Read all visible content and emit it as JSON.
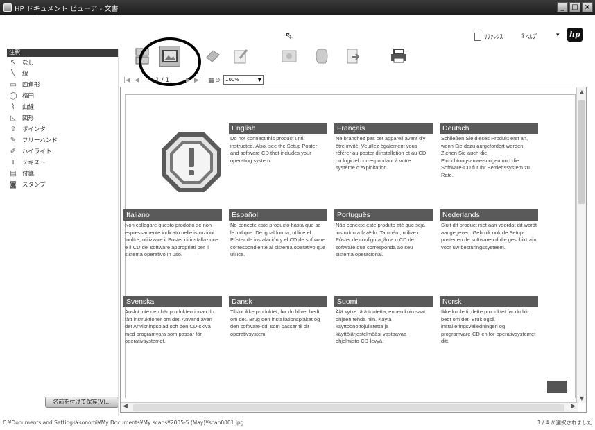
{
  "window": {
    "title": "HP ドキュメント ビューア - 文書",
    "minimize": "_",
    "maximize": "□",
    "close": "×"
  },
  "menu": {
    "reference": "ﾘﾌｧﾚﾝｽ",
    "help": "ﾍﾙﾌﾟ",
    "help_arrow": "▾",
    "brand": "hp"
  },
  "sidebar": {
    "header": "注釈",
    "items": [
      {
        "label": "なし",
        "icon": "pointer-icon",
        "glyph": "↖"
      },
      {
        "label": "線",
        "icon": "line-icon",
        "glyph": "╲"
      },
      {
        "label": "四角形",
        "icon": "rectangle-icon",
        "glyph": "▭"
      },
      {
        "label": "楕円",
        "icon": "ellipse-icon",
        "glyph": "◯"
      },
      {
        "label": "曲線",
        "icon": "curve-icon",
        "glyph": "⌇"
      },
      {
        "label": "図形",
        "icon": "polygon-icon",
        "glyph": "◺"
      },
      {
        "label": "ポインタ",
        "icon": "arrow-icon",
        "glyph": "⇧"
      },
      {
        "label": "フリーハンド",
        "icon": "freehand-icon",
        "glyph": "✎"
      },
      {
        "label": "ハイライト",
        "icon": "highlighter-icon",
        "glyph": "✐"
      },
      {
        "label": "テキスト",
        "icon": "text-icon",
        "glyph": "T"
      },
      {
        "label": "付箋",
        "icon": "note-icon",
        "glyph": "▤"
      },
      {
        "label": "スタンプ",
        "icon": "stamp-icon",
        "glyph": "◙"
      }
    ],
    "save_button": "名前を付けて保存(V)..."
  },
  "navigation": {
    "page_indicator": "1 / 1",
    "zoom": "100%"
  },
  "document": {
    "languages": [
      {
        "name": "English",
        "text": "Do not connect this product until instructed. Also, see the Setup Poster and software CD that includes your operating system."
      },
      {
        "name": "Français",
        "text": "Ne branchez pas cet appareil avant d'y être invité. Veuillez également vous référer au poster d'installation et au CD du logiciel correspondant à votre système d'exploitation."
      },
      {
        "name": "Deutsch",
        "text": "Schließen Sie dieses Produkt erst an, wenn Sie dazu aufgefordert werden. Ziehen Sie auch die Einrichtungsanweisungen und die Software-CD für Ihr Betriebssystem zu Rate."
      },
      {
        "name": "Italiano",
        "text": "Non collegare questo prodotto se non espressamente indicato nelle istruzioni. Inoltre, utilizzare il Poster di installazione e il CD del software appropriati per il sistema operativo in uso."
      },
      {
        "name": "Español",
        "text": "No conecte este producto hasta que se le indique. De igual forma, utilice el Póster de instalación y el CD de software correspondiente al sistema operativo que utilice."
      },
      {
        "name": "Português",
        "text": "Não conecte este produto até que seja instruído a fazê-lo. Também, utilize o Pôster de configuração e o CD de software que corresponda ao seu sistema operacional."
      },
      {
        "name": "Nederlands",
        "text": "Sluit dit product niet aan voordat dit wordt aangegeven. Gebruik ook de Setup-poster en de software-cd die geschikt zijn voor uw besturingssysteem."
      },
      {
        "name": "Svenska",
        "text": "Anslut inte den här produkten innan du fått instruktioner om det. Använd även det Anvisningsblad och den CD-skiva med programvara som passar för operativsystemet."
      },
      {
        "name": "Dansk",
        "text": "Tilslut ikke produktet, før du bliver bedt om det. Brug den installationsplakat og den software-cd, som passer til dit operativsystem."
      },
      {
        "name": "Suomi",
        "text": "Älä kytke tätä tuotetta, ennen kuin saat ohjeen tehdä niin. Käytä käyttöönottojulistetta ja käyttöjärjestelmääsi vastaavaa ohjelmisto-CD-levyä."
      },
      {
        "name": "Norsk",
        "text": "Ikke koble til dette produktet før du blir bedt om det. Bruk også installeringsveiledningen og programvare-CD-en for operativsystemet ditt."
      }
    ]
  },
  "status": {
    "path": "C:¥Documents and Settings¥sonomi¥My Documents¥My scans¥2005-5 (May)¥scan0001.jpg",
    "selection": "1 / 4 が選択されました"
  }
}
